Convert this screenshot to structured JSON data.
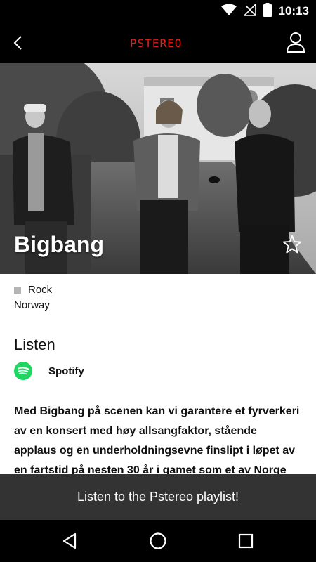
{
  "status_bar": {
    "time": "10:13",
    "icons": [
      "wifi-icon",
      "no-signal-icon",
      "battery-icon"
    ]
  },
  "app_bar": {
    "logo_text": "PSTEREO",
    "back_icon": "chevron-left-icon",
    "profile_icon": "person-icon"
  },
  "artist": {
    "name": "Bigbang",
    "genre": "Rock",
    "country": "Norway",
    "favorite_icon": "star-outline-icon"
  },
  "listen": {
    "heading": "Listen",
    "services": [
      {
        "name": "Spotify",
        "icon": "spotify-icon",
        "color": "#1ed760"
      }
    ]
  },
  "description": "Med Bigbang på scenen kan vi garantere et fyrverkeri av en konsert med høy allsangfaktor, stående applaus og en underholdningsevne finslipt i løpet av en fartstid på nesten 30 år i gamet som et av Norge",
  "playlist_button": {
    "label": "Listen to the Pstereo playlist!"
  },
  "nav_bar": {
    "icons": [
      "back-triangle-icon",
      "home-circle-icon",
      "recents-square-icon"
    ]
  },
  "colors": {
    "logo": "#e0201c",
    "bar_background": "#000000",
    "playlist_background": "#333333",
    "spotify": "#1ed760"
  }
}
